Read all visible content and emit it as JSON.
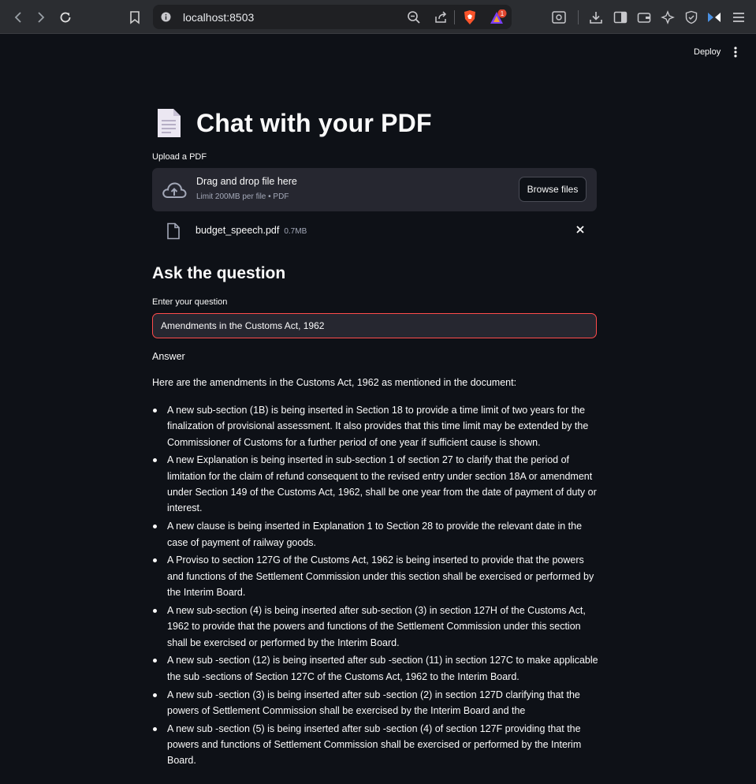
{
  "browser": {
    "url": "localhost:8503",
    "notification_count": "1"
  },
  "header": {
    "deploy_label": "Deploy"
  },
  "page": {
    "title": "Chat with your PDF"
  },
  "uploader": {
    "label": "Upload a PDF",
    "drop_title": "Drag and drop file here",
    "drop_subtitle": "Limit 200MB per file • PDF",
    "browse_label": "Browse files"
  },
  "uploaded_file": {
    "name": "budget_speech.pdf",
    "size": "0.7MB"
  },
  "question_section": {
    "heading": "Ask the question",
    "input_label": "Enter your question",
    "input_value": "Amendments in the Customs Act, 1962"
  },
  "answer": {
    "label": "Answer",
    "intro": "Here are the amendments in the Customs Act, 1962 as mentioned in the document:",
    "items": [
      "A new sub-section (1B) is being inserted in Section 18 to provide a time limit of two years for the finalization of provisional assessment. It also provides that this time limit may be extended by the Commissioner of Customs for a further period of one year if sufficient cause is shown.",
      "A new Explanation is being inserted in sub-section 1 of section 27 to clarify that the period of limitation for the claim of refund consequent to the revised entry under section 18A or amendment under Section 149 of the Customs Act, 1962, shall be one year from the date of payment of duty or interest.",
      "A new clause is being inserted in Explanation 1 to Section 28 to provide the relevant date in the case of payment of railway goods.",
      "A Proviso to section 127G of the Customs Act, 1962 is being inserted to provide that the powers and functions of the Settlement Commission under this section shall be exercised or performed by the Interim Board.",
      "A new sub-section (4) is being inserted after sub-section (3) in section 127H of the Customs Act, 1962 to provide that the powers and functions of the Settlement Commission under this section shall be exercised or performed by the Interim Board.",
      "A new sub -section (12) is being inserted after sub -section (11) in section 127C to make applicable the sub -sections of Section 127C of the Customs Act, 1962 to the Interim Board.",
      "A new sub -section (3) is being inserted after sub -section (2) in section 127D clarifying that the powers of Settlement Commission shall be exercised by the Interim Board and the",
      "A new sub -section (5) is being inserted after sub -section (4) of section 127F providing that the powers and functions of Settlement Commission shall be exercised or performed by the Interim Board."
    ]
  },
  "colors": {
    "background": "#0e1117",
    "widget_bg": "#262730",
    "focus_border": "#ff4b4b"
  },
  "icons": [
    "back-icon",
    "forward-icon",
    "reload-icon",
    "bookmark-icon",
    "site-info-icon",
    "zoom-icon",
    "share-icon",
    "brave-shield-icon",
    "brave-rewards-icon",
    "screenshot-icon",
    "download-icon",
    "sidebar-icon",
    "wallet-icon",
    "leo-icon",
    "vpn-icon",
    "extension-icon",
    "menu-icon",
    "kebab-icon",
    "document-icon",
    "cloud-upload-icon",
    "file-icon",
    "close-icon"
  ]
}
